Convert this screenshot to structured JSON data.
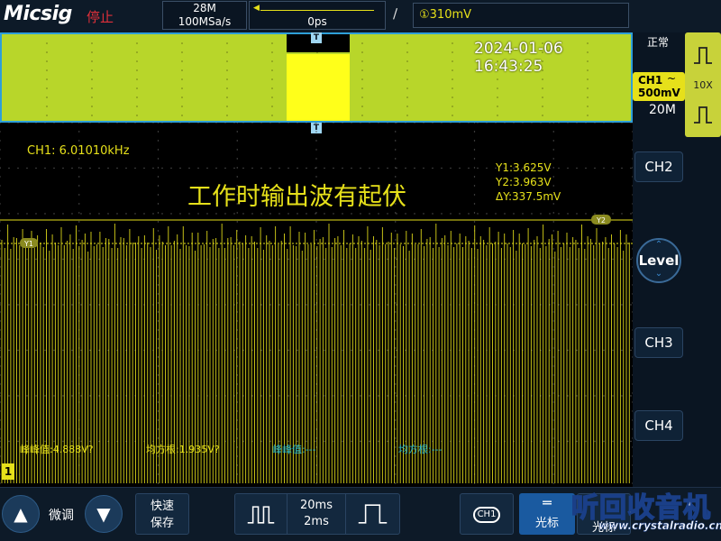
{
  "topbar": {
    "logo": "Micsig",
    "run_status": "停止",
    "memory_depth": "28M",
    "sample_rate": "100MSa/s",
    "horizontal_offset": "0ps",
    "trigger_edge_icon": "rising-edge-icon",
    "trigger_level": "①310mV"
  },
  "overview": {
    "datetime": "2024-01-06 16:43:25",
    "marker_label": "T"
  },
  "screen": {
    "frequency": "CH1: 6.01010kHz",
    "annotation": "工作时输出波有起伏",
    "cursor_y1": "Y1:3.625V",
    "cursor_y2": "Y2:3.963V",
    "cursor_dy": "ΔY:337.5mV",
    "y1_tag": "Y1",
    "y2_tag": "Y2",
    "ground_marker": "1"
  },
  "measurements": {
    "m1": "峰峰值:4.888V?",
    "m2": "均方根:1.935V?",
    "m3": "峰峰值:---",
    "m4": "均方根:---"
  },
  "rightpanel": {
    "trigger_mode": "正常",
    "ch1_label": "CH1",
    "ch1_coupling": "~",
    "ch1_scale": "500mV",
    "ch1_bandwidth": "20M",
    "probe_ratio": "10X",
    "ch2": "CH2",
    "level": "Level",
    "ch3": "CH3",
    "ch4": "CH4"
  },
  "bottombar": {
    "fine_label": "微调",
    "quicksave_line1": "快速",
    "quicksave_line2": "保存",
    "timebase_primary": "20ms",
    "timebase_secondary": "2ms",
    "channel_select": "CH1",
    "cursor_label": "光标",
    "cursor_label2": "光标"
  },
  "watermark": {
    "logo": "听回收音机",
    "url": "www.crystalradio.cn"
  },
  "colors": {
    "trace": "#e6e01a",
    "accent": "#2e9fd8",
    "stopped": "#e0303a",
    "math": "#2ab8c8"
  }
}
